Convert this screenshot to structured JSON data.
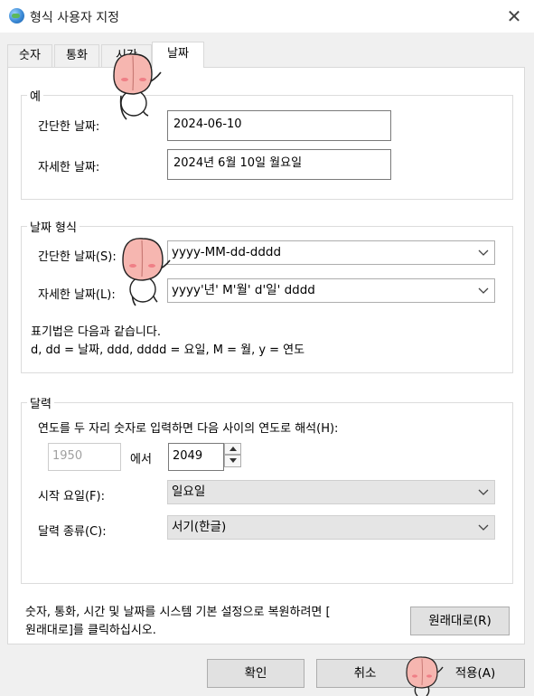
{
  "window": {
    "title": "형식 사용자 지정",
    "close_glyph": "✕"
  },
  "tabs": [
    {
      "label": "숫자",
      "active": false
    },
    {
      "label": "통화",
      "active": false
    },
    {
      "label": "시간",
      "active": false
    },
    {
      "label": "날짜",
      "active": true
    }
  ],
  "examples": {
    "group_title": "예",
    "short_label": "간단한 날짜:",
    "short_value": "2024-06-10",
    "long_label": "자세한 날짜:",
    "long_value": "2024년 6월 10일 월요일"
  },
  "formats": {
    "group_title": "날짜 형식",
    "short_label": "간단한 날짜(S):",
    "short_value": "yyyy-MM-dd-dddd",
    "long_label": "자세한 날짜(L):",
    "long_value": "yyyy'년' M'월' d'일' dddd",
    "notation_line1": "표기법은 다음과 같습니다.",
    "notation_line2": "d, dd = 날짜,  ddd, dddd = 요일,  M = 월,  y = 연도"
  },
  "calendar": {
    "group_title": "달력",
    "two_digit_label": "연도를 두 자리 숫자로 입력하면 다음 사이의 연도로 해석(H):",
    "year_from": "1950",
    "between_text": "에서",
    "year_to": "2049",
    "first_day_label": "시작 요일(F):",
    "first_day_value": "일요일",
    "calendar_type_label": "달력 종류(C):",
    "calendar_type_value": "서기(한글)"
  },
  "reset": {
    "text_line1": "숫자, 통화, 시간 및 날짜를 시스템 기본 설정으로 복원하려면 [",
    "text_line2": "원래대로]를 클릭하십시오.",
    "button_label": "원래대로(R)"
  },
  "footer": {
    "ok_label": "확인",
    "cancel_label": "취소",
    "apply_label": "적용(A)"
  },
  "colors": {
    "dialog_bg": "#f0f0f0",
    "panel_bg": "#ffffff",
    "button_bg": "#e1e1e1",
    "sticker_peach": "#f6b6b0"
  }
}
